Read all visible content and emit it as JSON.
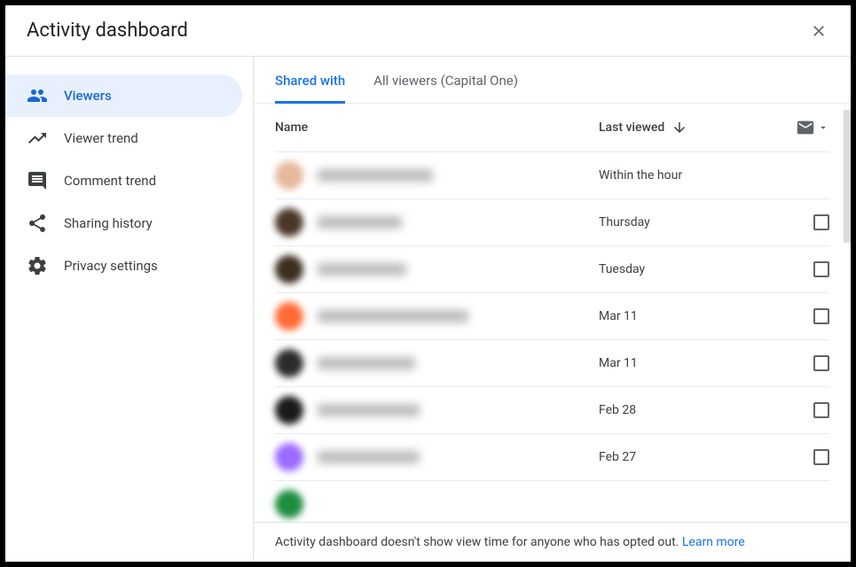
{
  "header": {
    "title": "Activity dashboard"
  },
  "sidebar": {
    "items": [
      {
        "label": "Viewers",
        "icon": "viewers",
        "active": true
      },
      {
        "label": "Viewer trend",
        "icon": "trend",
        "active": false
      },
      {
        "label": "Comment trend",
        "icon": "comment",
        "active": false
      },
      {
        "label": "Sharing history",
        "icon": "share",
        "active": false
      },
      {
        "label": "Privacy settings",
        "icon": "gear",
        "active": false
      }
    ]
  },
  "tabs": {
    "shared_with": "Shared with",
    "all_viewers": "All viewers",
    "org": "(Capital One)"
  },
  "table": {
    "headers": {
      "name": "Name",
      "last_viewed": "Last viewed"
    },
    "rows": [
      {
        "avatar_color": "#e6b89c",
        "name_width": 130,
        "last_viewed": "Within the hour",
        "checkbox": false
      },
      {
        "avatar_color": "#4a3728",
        "name_width": 95,
        "last_viewed": "Thursday",
        "checkbox": true
      },
      {
        "avatar_color": "#3d2f1f",
        "name_width": 100,
        "last_viewed": "Tuesday",
        "checkbox": true
      },
      {
        "avatar_color": "#ff6b35",
        "name_width": 170,
        "last_viewed": "Mar 11",
        "checkbox": true
      },
      {
        "avatar_color": "#2b2b2b",
        "name_width": 110,
        "last_viewed": "Mar 11",
        "checkbox": true
      },
      {
        "avatar_color": "#1a1a1a",
        "name_width": 115,
        "last_viewed": "Feb 28",
        "checkbox": true
      },
      {
        "avatar_color": "#9c6bff",
        "name_width": 115,
        "last_viewed": "Feb 27",
        "checkbox": true
      },
      {
        "avatar_color": "#1e8e3e",
        "name_width": 0,
        "last_viewed": "",
        "checkbox": false
      }
    ]
  },
  "footer": {
    "text": "Activity dashboard doesn't show view time for anyone who has opted out. ",
    "learn_more": "Learn more"
  }
}
